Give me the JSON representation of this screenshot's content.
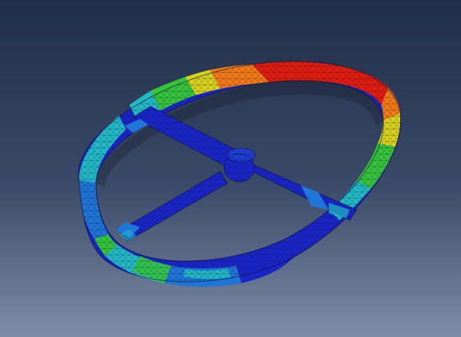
{
  "viewport": {
    "background_top": "#1f2d47",
    "background_mid": "#3a4a68",
    "background_bottom": "#7e8ca6"
  },
  "model": {
    "name": "steering-wheel-mesh",
    "mesh_line_color": "#0b1030",
    "contour_colors": {
      "max": "#e21d0d",
      "high": "#f37a14",
      "upper_mid": "#d9d21a",
      "mid": "#35c43a",
      "lower_mid": "#22b8c4",
      "low": "#1f76d6",
      "min": "#1a25c8"
    }
  }
}
